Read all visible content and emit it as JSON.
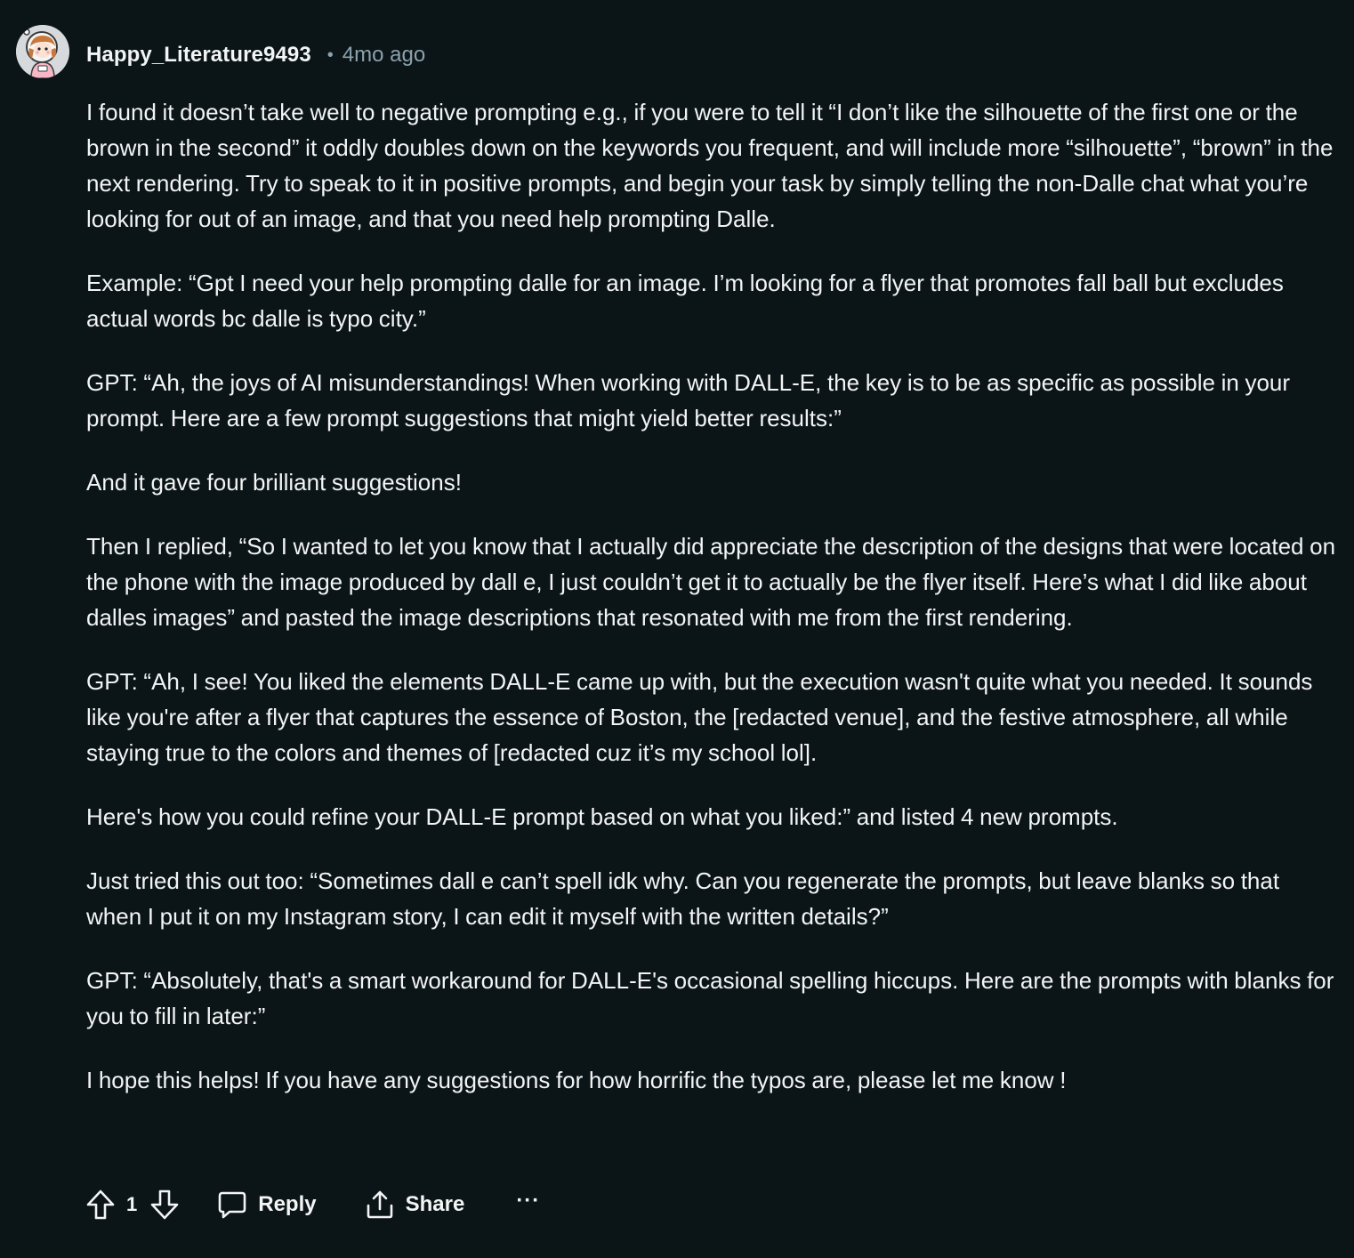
{
  "comment": {
    "author": "Happy_Literature9493",
    "separator": "•",
    "timestamp": "4mo ago",
    "avatar_icon": "astronaut-avatar",
    "paragraphs": [
      "I found it doesn’t take well to negative prompting e.g., if you were to tell it “I don’t like the silhouette of the first one or the brown in the second” it oddly doubles down on the keywords you frequent, and will include more “silhouette”, “brown” in the next rendering. Try to speak to it in positive prompts, and begin your task by simply telling the non-Dalle chat what you’re looking for out of an image, and that you need help prompting Dalle.",
      "Example: “Gpt I need your help prompting dalle for an image. I’m looking for a flyer that promotes fall ball but excludes actual words bc dalle is typo city.”",
      "GPT: “Ah, the joys of AI misunderstandings! When working with DALL-E, the key is to be as specific as possible in your prompt. Here are a few prompt suggestions that might yield better results:”",
      "And it gave four brilliant suggestions!",
      "Then I replied, “So I wanted to let you know that I actually did appreciate the description of the designs that were located on the phone with the image produced by dall e, I just couldn’t get it to actually be the flyer itself. Here’s what I did like about dalles images” and pasted the image descriptions that resonated with me from the first rendering.",
      "GPT: “Ah, I see! You liked the elements DALL-E came up with, but the execution wasn't quite what you needed. It sounds like you're after a flyer that captures the essence of Boston, the [redacted venue], and the festive atmosphere, all while staying true to the colors and themes of [redacted cuz it’s my school lol].",
      "Here's how you could refine your DALL-E prompt based on what you liked:” and listed 4 new prompts.",
      "Just tried this out too: “Sometimes dall e can’t spell idk why. Can you regenerate the prompts, but leave blanks so that when I put it on my Instagram story, I can edit it myself with the written details?”",
      "GPT: “Absolutely, that's a smart workaround for DALL-E's occasional spelling hiccups. Here are the prompts with blanks for you to fill in later:”",
      "I hope this helps! If you have any suggestions for how horrific the typos are, please let me know !"
    ]
  },
  "actions": {
    "upvote_icon": "upvote-arrow-icon",
    "vote_count": "1",
    "downvote_icon": "downvote-arrow-icon",
    "reply_label": "Reply",
    "reply_icon": "speech-bubble-icon",
    "share_label": "Share",
    "share_icon": "share-upload-icon",
    "more_label": "···"
  },
  "colors": {
    "background": "#0b1416",
    "text": "#f2f4f5",
    "muted": "#8ba2ad"
  }
}
